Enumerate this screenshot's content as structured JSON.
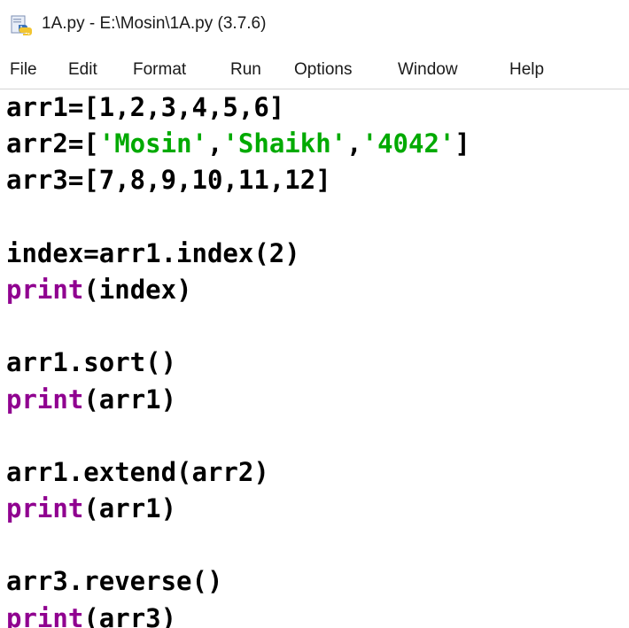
{
  "window": {
    "title": "1A.py - E:\\Mosin\\1A.py (3.7.6)",
    "icon": "python-file-icon"
  },
  "menu": [
    {
      "label": "File"
    },
    {
      "label": "Edit"
    },
    {
      "label": "Format"
    },
    {
      "label": "Run"
    },
    {
      "label": "Options"
    },
    {
      "label": "Window"
    },
    {
      "label": "Help"
    }
  ],
  "colors": {
    "string": "#00aa00",
    "builtin": "#900090",
    "default": "#000000"
  },
  "code": {
    "lines": [
      [
        {
          "t": "plain",
          "v": "arr1=[1,2,3,4,5,6]"
        }
      ],
      [
        {
          "t": "plain",
          "v": "arr2=["
        },
        {
          "t": "str",
          "v": "'Mosin'"
        },
        {
          "t": "plain",
          "v": ","
        },
        {
          "t": "str",
          "v": "'Shaikh'"
        },
        {
          "t": "plain",
          "v": ","
        },
        {
          "t": "str",
          "v": "'4042'"
        },
        {
          "t": "plain",
          "v": "]"
        }
      ],
      [
        {
          "t": "plain",
          "v": "arr3=[7,8,9,10,11,12]"
        }
      ],
      [],
      [
        {
          "t": "plain",
          "v": "index=arr1.index(2)"
        }
      ],
      [
        {
          "t": "builtin",
          "v": "print"
        },
        {
          "t": "plain",
          "v": "(index)"
        }
      ],
      [],
      [
        {
          "t": "plain",
          "v": "arr1.sort()"
        }
      ],
      [
        {
          "t": "builtin",
          "v": "print"
        },
        {
          "t": "plain",
          "v": "(arr1)"
        }
      ],
      [],
      [
        {
          "t": "plain",
          "v": "arr1.extend(arr2)"
        }
      ],
      [
        {
          "t": "builtin",
          "v": "print"
        },
        {
          "t": "plain",
          "v": "(arr1)"
        }
      ],
      [],
      [
        {
          "t": "plain",
          "v": "arr3.reverse()"
        }
      ],
      [
        {
          "t": "builtin",
          "v": "print"
        },
        {
          "t": "plain",
          "v": "(arr3)"
        }
      ]
    ]
  }
}
